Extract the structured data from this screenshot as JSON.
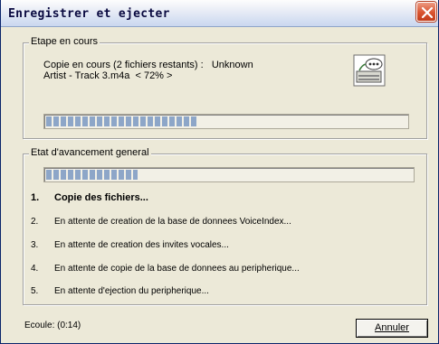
{
  "window": {
    "title": "Enregistrer et ejecter"
  },
  "current_step_group": {
    "legend": "Etape en cours",
    "status_line": "Copie en cours (2 fichiers restants) :   Unknown",
    "file_line": "Artist - Track 3.m4a  < 72% >",
    "progress": 0.42,
    "device_icon": "ipod-dock-icon"
  },
  "overall_group": {
    "legend": "Etat d'avancement general",
    "progress": 0.25,
    "steps": [
      {
        "num": "1.",
        "label": "Copie des fichiers...",
        "active": true
      },
      {
        "num": "2.",
        "label": "En attente de creation de la base de donnees VoiceIndex...",
        "active": false
      },
      {
        "num": "3.",
        "label": "En attente de creation des invites vocales...",
        "active": false
      },
      {
        "num": "4.",
        "label": "En attente de copie de la base de donnees au peripherique...",
        "active": false
      },
      {
        "num": "5.",
        "label": "En attente d'ejection du peripherique...",
        "active": false
      }
    ]
  },
  "footer": {
    "elapsed": "Ecoule: (0:14)",
    "cancel_label": "Annuler"
  },
  "colors": {
    "progress_fill": "#8da6c8",
    "close_button": "#d9532f"
  }
}
